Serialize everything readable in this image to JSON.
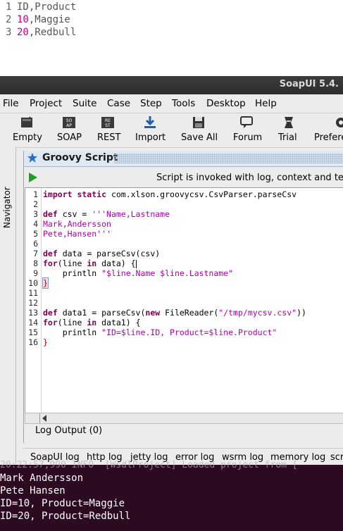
{
  "csv_file": {
    "lines": [
      {
        "num": "1",
        "first": "ID",
        "rest": ",Product"
      },
      {
        "num": "2",
        "first": "10",
        "rest": ",Maggie"
      },
      {
        "num": "3",
        "first": "20",
        "rest": ",Redbull"
      }
    ]
  },
  "window": {
    "title": "SoapUI 5.4."
  },
  "menu": [
    "File",
    "Project",
    "Suite",
    "Case",
    "Step",
    "Tools",
    "Desktop",
    "Help"
  ],
  "toolbar": [
    {
      "label": "Empty",
      "icon": "empty-project-icon"
    },
    {
      "label": "SOAP",
      "icon": "soap-icon"
    },
    {
      "label": "REST",
      "icon": "rest-icon"
    },
    {
      "label": "Import",
      "icon": "import-icon"
    },
    {
      "label": "Save All",
      "icon": "save-all-icon"
    },
    {
      "label": "Forum",
      "icon": "forum-icon"
    },
    {
      "label": "Trial",
      "icon": "trial-icon"
    },
    {
      "label": "Prefere",
      "icon": "preferences-icon"
    }
  ],
  "navigator": {
    "label": "Navigator"
  },
  "script_panel": {
    "title": "Groovy Script",
    "info": "Script is invoked with log, context and tes",
    "log_output_tab": "Log Output (0)"
  },
  "code": {
    "line_numbers": [
      "1",
      "2",
      "3",
      "4",
      "5",
      "6",
      "7",
      "8",
      "9",
      "10",
      "11",
      "12",
      "13",
      "14",
      "15",
      "16"
    ],
    "l1_kw": "import static",
    "l1_rest": " com.xlson.groovycsv.CsvParser.parseCsv",
    "l3_kw": "def",
    "l3_a": " csv = ",
    "l3_str": "'''Name,Lastname",
    "l4_str": "Mark,Andersson",
    "l5_str": "Pete,Hansen'''",
    "l7_kw": "def",
    "l7_rest": " data = parseCsv(csv)",
    "l8_kw": "for",
    "l8_a": "(line ",
    "l8_kw2": "in",
    "l8_b": " data) {",
    "l9_a": "    println ",
    "l9_str": "\"$line.Name $line.Lastname\"",
    "l10": "}",
    "l13_kw": "def",
    "l13_a": " data1 = parseCsv(",
    "l13_kw2": "new",
    "l13_b": " FileReader(",
    "l13_str": "\"/tmp/mycsv.csv\"",
    "l13_c": "))",
    "l14_kw": "for",
    "l14_a": "(line ",
    "l14_kw2": "in",
    "l14_b": " data1) {",
    "l15_a": "    println ",
    "l15_str": "\"ID=$line.ID, Product=$line.Product\"",
    "l16": "}"
  },
  "bottom_tabs": [
    "SoapUI log",
    "http log",
    "jetty log",
    "error log",
    "wsrm log",
    "memory log",
    "scr"
  ],
  "terminal": {
    "partial_line": "20:22:57,990 INFO  [WsdlProject] Loaded project from [",
    "lines": [
      "Mark Andersson",
      "Pete Hansen",
      "ID=10, Product=Maggie",
      "ID=20, Product=Redbull"
    ]
  },
  "colors": {
    "terminal_bg": "#2b0a22",
    "titlebar_bg": "#2d2d2d",
    "keyword": "#7f0055",
    "string": "#b000b0"
  }
}
